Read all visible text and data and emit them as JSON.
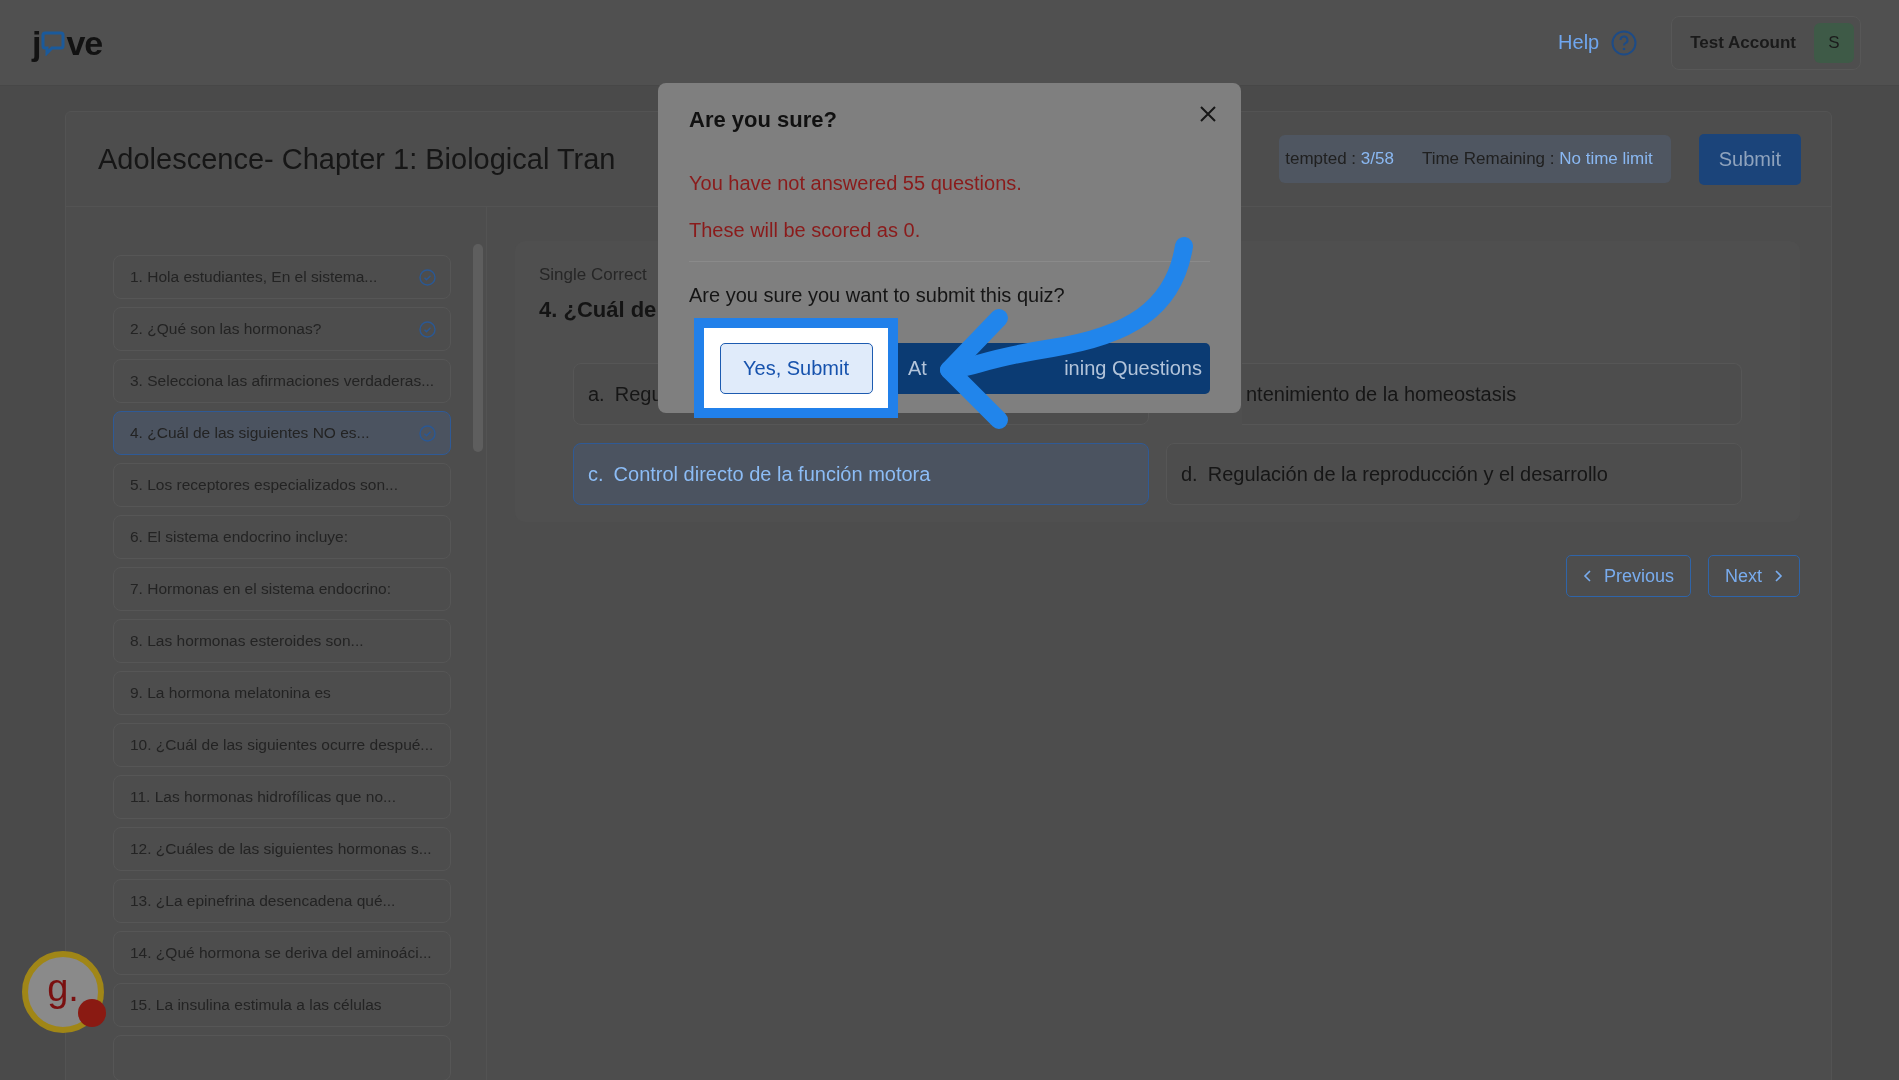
{
  "logo": {
    "start": "j",
    "end": "ve"
  },
  "header": {
    "help": "Help",
    "account": "Test Account",
    "avatar": "S"
  },
  "quiz": {
    "title": "Adolescence- Chapter 1: Biological Tran",
    "stats": [
      {
        "label": "tempted : ",
        "value": "3/58"
      },
      {
        "label": "Time Remaining : ",
        "value": "No time limit"
      }
    ],
    "submit": "Submit"
  },
  "questions": [
    {
      "label": "1.  Hola estudiantes, En el sistema...",
      "answered": true,
      "selected": false
    },
    {
      "label": "2. ¿Qué son las hormonas?",
      "answered": true,
      "selected": false
    },
    {
      "label": "3. Selecciona las afirmaciones verdaderas...",
      "answered": false,
      "selected": false
    },
    {
      "label": "4. ¿Cuál de las siguientes NO es...",
      "answered": true,
      "selected": true
    },
    {
      "label": "5. Los receptores especializados son...",
      "answered": false,
      "selected": false
    },
    {
      "label": "6. El sistema endocrino incluye:",
      "answered": false,
      "selected": false
    },
    {
      "label": "7. Hormonas en el sistema endocrino:",
      "answered": false,
      "selected": false
    },
    {
      "label": "8. Las hormonas esteroides son...",
      "answered": false,
      "selected": false
    },
    {
      "label": "9. La hormona melatonina es",
      "answered": false,
      "selected": false
    },
    {
      "label": "10. ¿Cuál de las siguientes ocurre despué...",
      "answered": false,
      "selected": false
    },
    {
      "label": "11. Las hormonas hidrofílicas que no...",
      "answered": false,
      "selected": false
    },
    {
      "label": "12. ¿Cuáles de las siguientes hormonas s...",
      "answered": false,
      "selected": false
    },
    {
      "label": "13. ¿La epinefrina desencadena qué...",
      "answered": false,
      "selected": false
    },
    {
      "label": "14. ¿Qué hormona se deriva del aminoáci...",
      "answered": false,
      "selected": false
    },
    {
      "label": "15. La insulina estimula a las células",
      "answered": false,
      "selected": false
    }
  ],
  "question": {
    "type": "Single Correct",
    "title": "4. ¿Cuál de",
    "options": [
      {
        "letter": "a.",
        "text": "Regu",
        "selected": false
      },
      {
        "text": "ntenimiento de la homeostasis",
        "selected": false
      },
      {
        "letter": "c.",
        "text": "Control directo de la función motora",
        "selected": true
      },
      {
        "letter": "d.",
        "text": "Regulación de la reproducción y el desarrollo",
        "selected": false
      }
    ]
  },
  "nav": {
    "previous": "Previous",
    "next": "Next"
  },
  "modal": {
    "title": "Are you sure?",
    "warnings": [
      "You have not answered 55 questions.",
      "These will be scored as 0."
    ],
    "question": "Are you sure you want to submit this quiz?",
    "confirm": "Yes, Submit",
    "attempt": [
      "At",
      "ining Questions"
    ]
  },
  "badge": {
    "text": "g."
  }
}
